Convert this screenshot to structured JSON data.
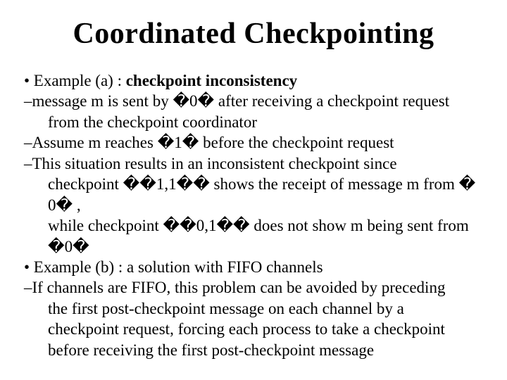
{
  "title": "Coordinated Checkpointing",
  "glyph": "�",
  "lines": {
    "l1a": "• Example (a) : ",
    "l1b": "checkpoint inconsistency",
    "l2a": "–message m is sent by ",
    "l2b": "0",
    "l2c": " after receiving a checkpoint request",
    "l3": "from the checkpoint coordinator",
    "l4a": "–Assume m reaches ",
    "l4b": "1",
    "l4c": " before the checkpoint request",
    "l5": "–This situation results in an inconsistent checkpoint since",
    "l6a": "checkpoint ",
    "l6b": "1,1",
    "l6c": " shows the receipt of message m from ",
    "l6d": "0",
    "l6e": " ,",
    "l7a": "while checkpoint ",
    "l7b": "0,1",
    "l7c": " does not show m being sent from ",
    "l7d": "0",
    "l8": "• Example (b) : a solution with FIFO channels",
    "l9": "–If channels are FIFO, this problem can be avoided by preceding",
    "l10": "the first post-checkpoint message on each channel by a",
    "l11": "checkpoint request, forcing each process to take a checkpoint",
    "l12": "before receiving the first post-checkpoint message"
  }
}
